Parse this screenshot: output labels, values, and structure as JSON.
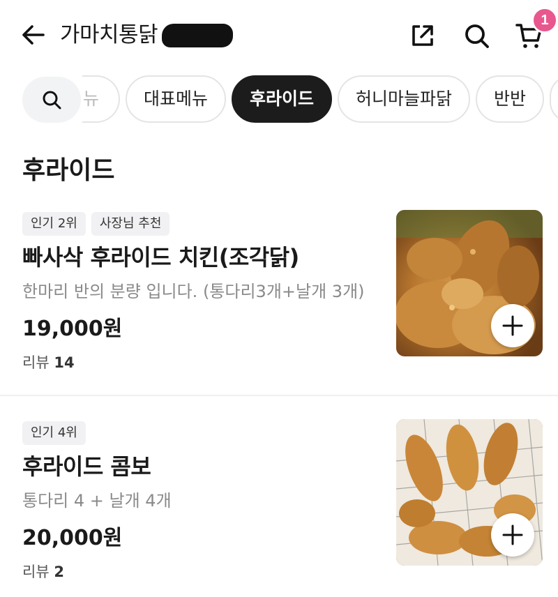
{
  "header": {
    "store_name": "가마치통닭",
    "cart_count": "1"
  },
  "categories": {
    "cut_label": "뉴",
    "chips": [
      {
        "label": "대표메뉴",
        "active": false
      },
      {
        "label": "후라이드",
        "active": true
      },
      {
        "label": "허니마늘파닭",
        "active": false
      },
      {
        "label": "반반",
        "active": false
      }
    ]
  },
  "section": {
    "title": "후라이드"
  },
  "items": [
    {
      "tags": [
        "인기 2위",
        "사장님 추천"
      ],
      "name": "빠사삭 후라이드 치킨(조각닭)",
      "description": "한마리 반의 분량 입니다. (통다리3개+날개 3개)",
      "price": "19,000원",
      "review_label": "리뷰",
      "review_count": "14"
    },
    {
      "tags": [
        "인기 4위"
      ],
      "name": "후라이드 콤보",
      "description": "통다리 4 + 날개 4개",
      "price": "20,000원",
      "review_label": "리뷰",
      "review_count": "2"
    }
  ],
  "colors": {
    "badge": "#e8578e",
    "active_chip": "#1c1c1c"
  }
}
